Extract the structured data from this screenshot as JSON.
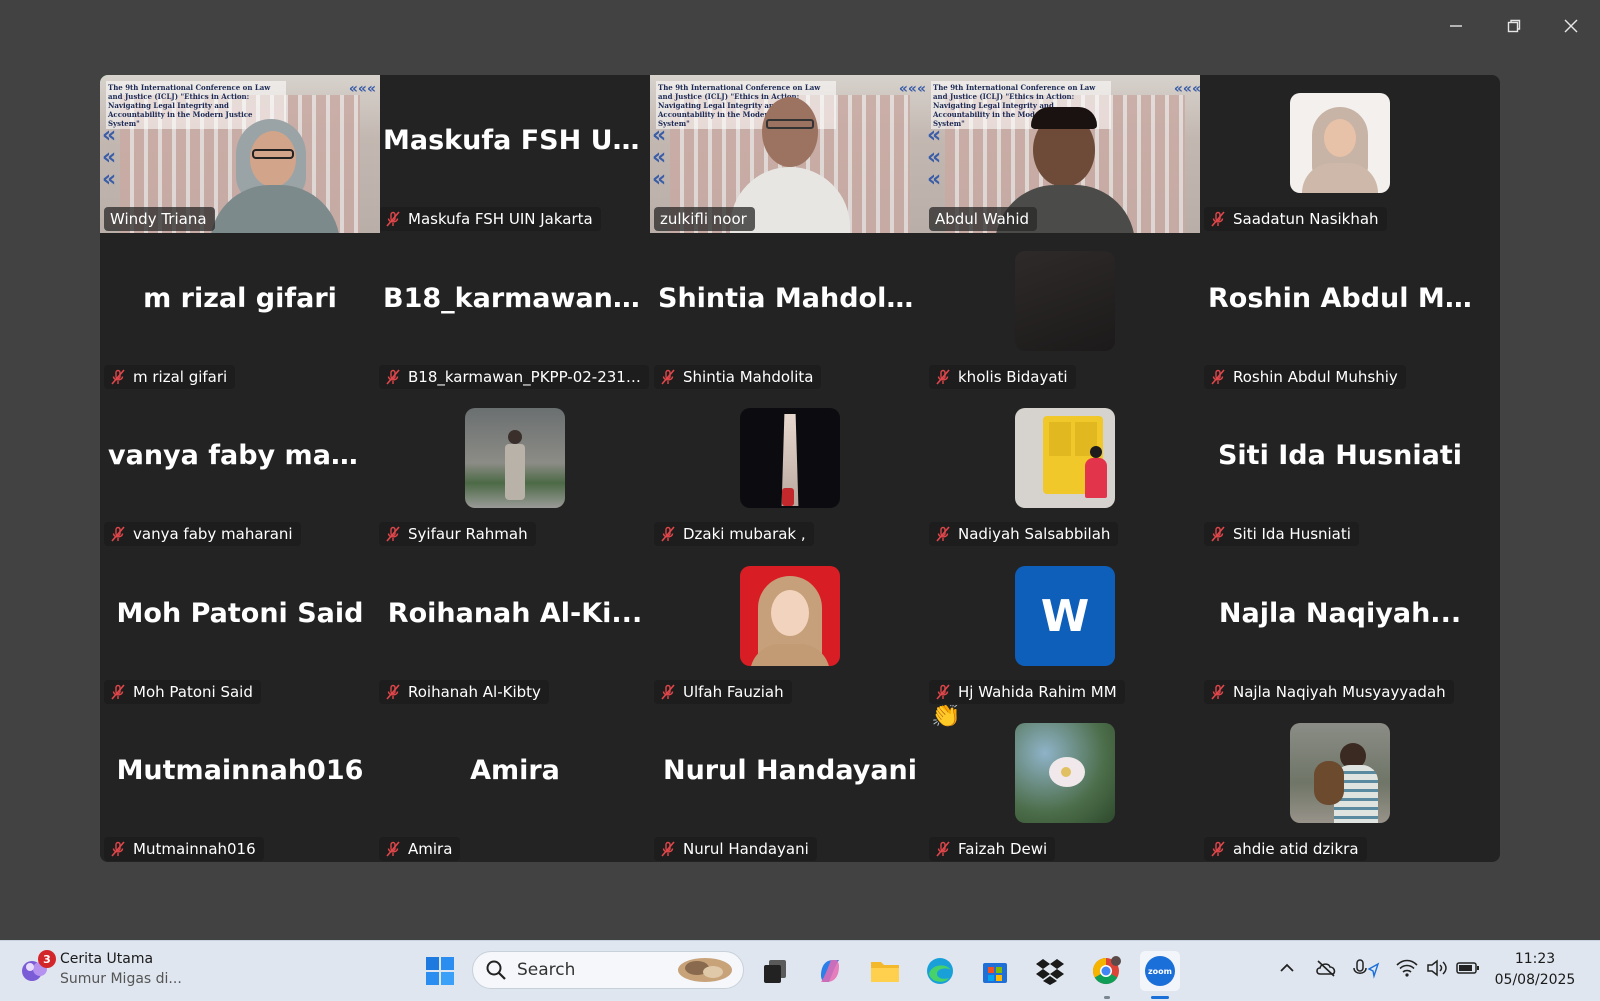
{
  "window": {
    "controls": [
      "minimize-icon",
      "restore-icon",
      "close-icon"
    ]
  },
  "gallery": {
    "participants": [
      {
        "name": "Windy Triana",
        "display": "",
        "type": "video",
        "active": true,
        "muted": false
      },
      {
        "name": "Maskufa FSH UIN Jakarta",
        "display": "Maskufa FSH UI...",
        "type": "name",
        "muted": true
      },
      {
        "name": "zulkifli noor",
        "display": "",
        "type": "video",
        "muted": false
      },
      {
        "name": "Abdul Wahid",
        "display": "",
        "type": "video",
        "muted": false
      },
      {
        "name": "Saadatun Nasikhah",
        "display": "",
        "type": "photo",
        "photo": "hijab-woman",
        "muted": true
      },
      {
        "name": "m rizal gifari",
        "display": "m rizal gifari",
        "type": "name",
        "muted": true
      },
      {
        "name": "B18_karmawan_PKPP-02-231-000...",
        "display": "B18_karmawan_...",
        "type": "name",
        "muted": true
      },
      {
        "name": "Shintia Mahdolita",
        "display": "Shintia Mahdolita",
        "type": "name",
        "muted": true
      },
      {
        "name": "kholis Bidayati",
        "display": "",
        "type": "photo",
        "photo": "dark",
        "muted": true
      },
      {
        "name": "Roshin Abdul Muhshiy",
        "display": "Roshin Abdul M...",
        "type": "name",
        "muted": true
      },
      {
        "name": "vanya faby maharani",
        "display": "vanya faby mah...",
        "type": "name",
        "muted": true
      },
      {
        "name": "Syifaur Rahmah",
        "display": "",
        "type": "photo",
        "photo": "outdoor-person",
        "muted": true
      },
      {
        "name": "Dzaki mubarak ,",
        "display": "",
        "type": "photo",
        "photo": "tower-night",
        "muted": true
      },
      {
        "name": "Nadiyah Salsabbilah",
        "display": "",
        "type": "photo",
        "photo": "yellow-door",
        "muted": true
      },
      {
        "name": "Siti Ida Husniati",
        "display": "Siti Ida Husniati",
        "type": "name",
        "muted": true
      },
      {
        "name": "Moh Patoni Said",
        "display": "Moh Patoni Said",
        "type": "name",
        "muted": true
      },
      {
        "name": "Roihanah Al-Kibty",
        "display": "Roihanah Al-Ki...",
        "type": "name",
        "muted": true
      },
      {
        "name": "Ulfah Fauziah",
        "display": "",
        "type": "photo",
        "photo": "red-portrait",
        "muted": true
      },
      {
        "name": "Hj Wahida Rahim MM",
        "display": "",
        "type": "letter",
        "letter": "W",
        "muted": true
      },
      {
        "name": "Najla Naqiyah Musyayyadah",
        "display": "Najla Naqiyah...",
        "type": "name",
        "muted": true
      },
      {
        "name": "Mutmainnah016",
        "display": "Mutmainnah016",
        "type": "name",
        "muted": true
      },
      {
        "name": "Amira",
        "display": "Amira",
        "type": "name",
        "muted": true
      },
      {
        "name": "Nurul Handayani",
        "display": "Nurul Handayani",
        "type": "name",
        "muted": true
      },
      {
        "name": "Faizah Dewi",
        "display": "",
        "type": "photo",
        "photo": "flower",
        "muted": true,
        "reaction": "👏"
      },
      {
        "name": "ahdie atid dzikra",
        "display": "",
        "type": "photo",
        "photo": "bird-holder",
        "muted": true
      }
    ],
    "video_banner": "The 9th International Conference on Law and Justice (ICLJ) \"Ethics in Action: Navigating Legal Integrity and Accountability in the Modern Justice System\""
  },
  "taskbar": {
    "news": {
      "badge": "3",
      "title": "Cerita Utama",
      "subtitle": "Sumur Migas di..."
    },
    "search": {
      "placeholder": "Search"
    },
    "clock": {
      "time": "11:23",
      "date": "05/08/2025"
    },
    "colors": {
      "accent": "#1b6fd8",
      "active_speaker": "#23d959",
      "mute": "#e0464a"
    }
  }
}
